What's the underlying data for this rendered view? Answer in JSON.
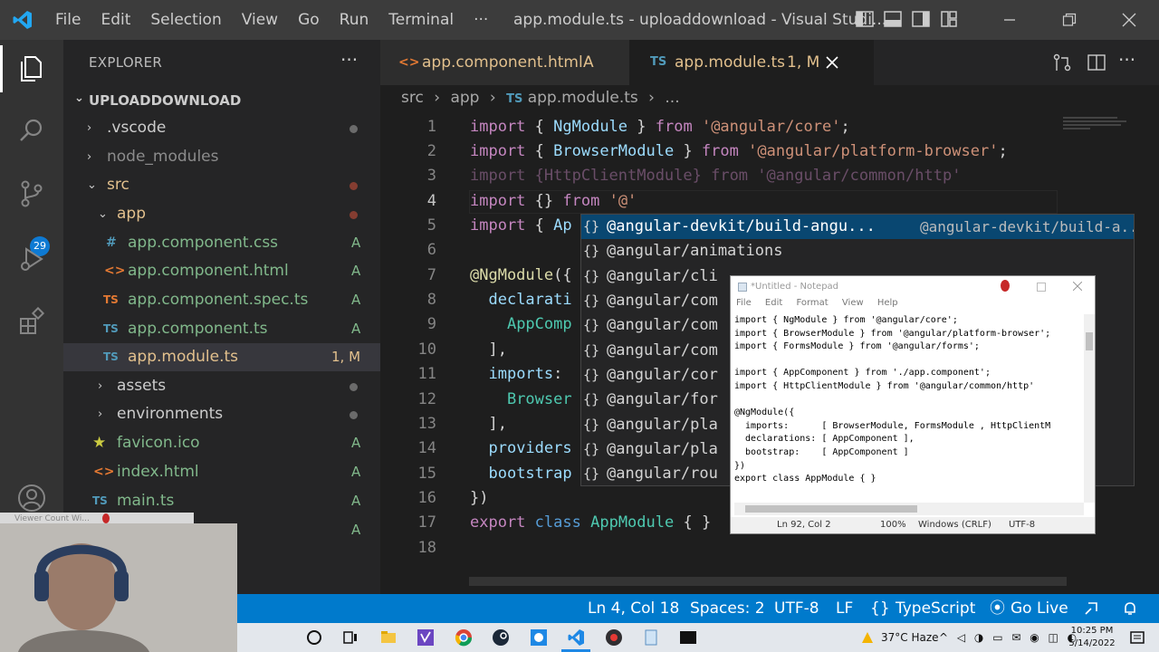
{
  "menu": [
    "File",
    "Edit",
    "Selection",
    "View",
    "Go",
    "Run",
    "Terminal",
    "···"
  ],
  "window_title": "app.module.ts - uploaddownload - Visual Studi...",
  "sidebar": {
    "header": "EXPLORER",
    "more": "···",
    "root": "UPLOADDOWNLOAD",
    "items": [
      {
        "name": ".vscode",
        "kind": "folder",
        "status": "",
        "dot": "#4b4b4b"
      },
      {
        "name": "node_modules",
        "kind": "folder",
        "status": "",
        "dot": ""
      },
      {
        "name": "src",
        "kind": "folder-open",
        "status": "",
        "dot": "#c74e39"
      },
      {
        "name": "app",
        "kind": "folder-open",
        "status": "",
        "dot": "#c74e39"
      },
      {
        "name": "app.component.css",
        "icon": "#",
        "status": "A"
      },
      {
        "name": "app.component.html",
        "icon": "<>",
        "status": "A"
      },
      {
        "name": "app.component.spec.ts",
        "icon": "TS",
        "status": "A"
      },
      {
        "name": "app.component.ts",
        "icon": "TS",
        "status": "A"
      },
      {
        "name": "app.module.ts",
        "icon": "TS",
        "status": "1, M"
      },
      {
        "name": "assets",
        "kind": "folder",
        "status": "",
        "dot": "#4b4b4b"
      },
      {
        "name": "environments",
        "kind": "folder",
        "status": "",
        "dot": "#4b4b4b"
      },
      {
        "name": "favicon.ico",
        "icon": "★",
        "status": "A"
      },
      {
        "name": "index.html",
        "icon": "<>",
        "status": "A"
      },
      {
        "name": "main.ts",
        "icon": "TS",
        "status": "A"
      },
      {
        "name": "",
        "icon": "",
        "status": "A"
      }
    ],
    "source_control_badge": "29"
  },
  "tabs": [
    {
      "icon": "<>",
      "label": "app.component.html",
      "status": "A"
    },
    {
      "icon": "TS",
      "label": "app.module.ts",
      "status": "1, M"
    }
  ],
  "breadcrumb": [
    "src",
    "app",
    "app.module.ts",
    "..."
  ],
  "breadcrumb_ts": "TS",
  "editor": {
    "lines": [
      "1",
      "2",
      "3",
      "4",
      "5",
      "6",
      "7",
      "8",
      "9",
      "10",
      "11",
      "12",
      "13",
      "14",
      "15",
      "16",
      "17",
      "18"
    ],
    "code": {
      "l1": [
        "import",
        " { ",
        "NgModule",
        " } ",
        "from",
        " ",
        "'@angular/core'",
        ";"
      ],
      "l2": [
        "import",
        " { ",
        "BrowserModule",
        " } ",
        "from",
        " ",
        "'@angular/platform-browser'",
        ";"
      ],
      "l3": [
        "import {HttpClientModule} from '@angular/common/http'"
      ],
      "l4": [
        "import",
        " {} ",
        "from",
        " ",
        "'@'"
      ],
      "l5": [
        "import",
        " { ",
        "Ap"
      ],
      "l7": [
        "@NgModule",
        "({"
      ],
      "l8": [
        "  ",
        "declarati"
      ],
      "l9": [
        "    ",
        "AppComp"
      ],
      "l10": [
        "  ],"
      ],
      "l11": [
        "  ",
        "imports",
        ": "
      ],
      "l12": [
        "    ",
        "Browser"
      ],
      "l13": [
        "  ],"
      ],
      "l14": [
        "  ",
        "providers"
      ],
      "l15": [
        "  ",
        "bootstrap"
      ],
      "l16": [
        "})"
      ],
      "l17": [
        "export",
        " ",
        "class",
        " ",
        "AppModule",
        " { }"
      ]
    }
  },
  "suggestions": [
    {
      "text": "@angular-devkit/build-angu...",
      "detail": "@angular-devkit/build-a..."
    },
    {
      "text": "@angular/animations",
      "detail": ""
    },
    {
      "text": "@angular/cli",
      "detail": ""
    },
    {
      "text": "@angular/com",
      "detail": ""
    },
    {
      "text": "@angular/com",
      "detail": ""
    },
    {
      "text": "@angular/com",
      "detail": ""
    },
    {
      "text": "@angular/cor",
      "detail": ""
    },
    {
      "text": "@angular/for",
      "detail": ""
    },
    {
      "text": "@angular/pla",
      "detail": ""
    },
    {
      "text": "@angular/pla",
      "detail": ""
    },
    {
      "text": "@angular/rou",
      "detail": ""
    }
  ],
  "notepad": {
    "title": "*Untitled - Notepad",
    "menu": [
      "File",
      "Edit",
      "Format",
      "View",
      "Help"
    ],
    "text": "import { NgModule } from '@angular/core';\nimport { BrowserModule } from '@angular/platform-browser';\nimport { FormsModule } from '@angular/forms';\n\nimport { AppComponent } from './app.component';\nimport { HttpClientModule } from '@angular/common/http'\n\n@NgModule({\n  imports:      [ BrowserModule, FormsModule , HttpClientM\n  declarations: [ AppComponent ],\n  bootstrap:    [ AppComponent ]\n})\nexport class AppModule { }",
    "status": {
      "pos": "Ln 92, Col 2",
      "zoom": "100%",
      "eol": "Windows (CRLF)",
      "enc": "UTF-8"
    }
  },
  "statusbar": {
    "position": "Ln 4, Col 18",
    "spaces": "Spaces: 2",
    "encoding": "UTF-8",
    "eol": "LF",
    "language_icon": "{}",
    "language": "TypeScript",
    "golive": "Go Live"
  },
  "taskbar": {
    "weather": "37°C  Haze",
    "time": "10:25 PM",
    "date": "5/14/2022"
  },
  "overlay": {
    "viewer_label": "Viewer Count Wi..."
  },
  "colors": {
    "accent": "#007acc",
    "modified": "#e2c08d",
    "added": "#81b88b"
  }
}
